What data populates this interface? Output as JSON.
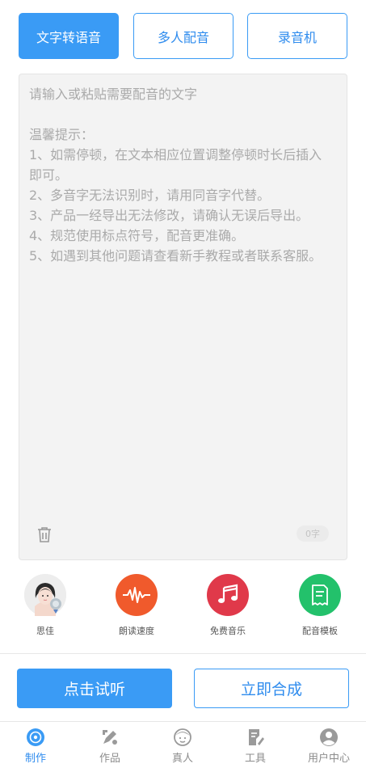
{
  "tabs": [
    {
      "label": "文字转语音",
      "active": true
    },
    {
      "label": "多人配音",
      "active": false
    },
    {
      "label": "录音机",
      "active": false
    }
  ],
  "editor": {
    "placeholder": "请输入或粘贴需要配音的文字\n\n温馨提示：\n1、如需停顿，在文本相应位置调整停顿时长后插入即可。\n2、多音字无法识别时，请用同音字代替。\n3、产品一经导出无法修改，请确认无误后导出。\n4、规范使用标点符号，配音更准确。\n5、如遇到其他问题请查看新手教程或者联系客服。",
    "char_count": "0字"
  },
  "tools": [
    {
      "label": "思佳",
      "icon": "voice-avatar-icon"
    },
    {
      "label": "朗读速度",
      "icon": "waveform-icon",
      "color": "#f05a2c"
    },
    {
      "label": "免费音乐",
      "icon": "music-note-icon",
      "color": "#e0394a"
    },
    {
      "label": "配音模板",
      "icon": "template-icon",
      "color": "#23c16b"
    }
  ],
  "actions": {
    "listen": "点击试听",
    "synthesize": "立即合成"
  },
  "nav": [
    {
      "label": "制作",
      "icon": "make-icon",
      "active": true
    },
    {
      "label": "作品",
      "icon": "works-icon",
      "active": false
    },
    {
      "label": "真人",
      "icon": "human-voice-icon",
      "active": false
    },
    {
      "label": "工具",
      "icon": "tools-icon",
      "active": false
    },
    {
      "label": "用户中心",
      "icon": "user-center-icon",
      "active": false
    }
  ],
  "colors": {
    "accent": "#3a9bf5",
    "inactive": "#8c8c8c"
  }
}
